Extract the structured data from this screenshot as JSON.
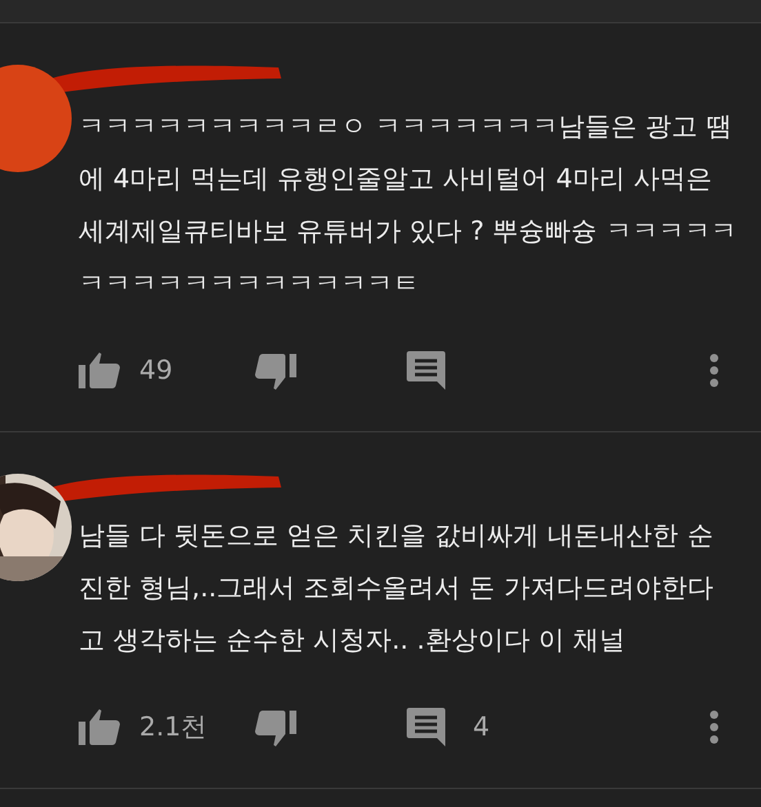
{
  "comments": [
    {
      "avatar": {
        "kind": "color",
        "color": "#d84315"
      },
      "text": "ㅋㅋㅋㅋㅋㅋㅋㅋㅋㄹㅇ ㅋㅋㅋㅋㅋㅋㅋ남들은 광고 땜에 4마리 먹는데 유행인줄알고 사비털어 4마리 사먹은 세계제일큐티바보 유튜버가 있다 ? 뿌슝빠슝 ㅋㅋㅋㅋㅋㅋㅋㅋㅋㅋㅋㅋㅋㅋㅋㅋㅋㅌ",
      "likes": "49"
    },
    {
      "text": "남들 다 뒷돈으로 얻은 치킨을 값비싸게 내돈내산한 순진한 형님,..그래서 조회수올려서 돈 가져다드려야한다고 생각하는 순수한 시청자.. .환상이다 이 채널",
      "likes": "2.1천",
      "replies": "4"
    }
  ]
}
